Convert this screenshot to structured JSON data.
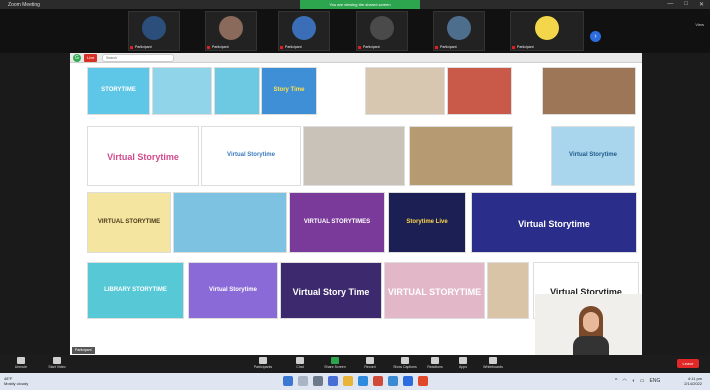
{
  "window": {
    "title": "Zoom Meeting",
    "banner": "You are viewing the shared screen"
  },
  "participants": [
    {
      "name": "Participant",
      "avatar_color": "#2b4f7a"
    },
    {
      "name": "Participant",
      "avatar_color": "#8a6a5a"
    },
    {
      "name": "Participant",
      "avatar_color": "#3a6fb8"
    },
    {
      "name": "Participant",
      "avatar_color": "#4a4a4a"
    },
    {
      "name": "Participant",
      "avatar_color": "#4e6e8e"
    },
    {
      "name": "Participant",
      "avatar_color": "#f3d64a"
    }
  ],
  "strip_next": "›",
  "view_label": "View",
  "browser": {
    "logo": "G",
    "live_badge": "Live",
    "tab_label": "Search"
  },
  "thumbnails": [
    {
      "text": "STORYTIME",
      "bg": "#5ec6e6",
      "fg": "#ffffff"
    },
    {
      "text": "",
      "bg": "#8fd4e8",
      "fg": "#333333"
    },
    {
      "text": "",
      "bg": "#6dc8e2",
      "fg": "#333333"
    },
    {
      "text": "Story Time",
      "bg": "#3e8fd6",
      "fg": "#ffe24a"
    },
    {
      "text": "",
      "bg": "#d8c7b0",
      "fg": "#333333"
    },
    {
      "text": "",
      "bg": "#c95a4a",
      "fg": "#ffffff"
    },
    {
      "text": "",
      "bg": "#9c7656",
      "fg": "#ffffff"
    },
    {
      "text": "Virtual Storytime",
      "bg": "#ffffff",
      "fg": "#d24a8c"
    },
    {
      "text": "Virtual Storytime",
      "bg": "#ffffff",
      "fg": "#3a7ab8"
    },
    {
      "text": "",
      "bg": "#c9c2b8",
      "fg": "#333333"
    },
    {
      "text": "",
      "bg": "#b69a72",
      "fg": "#333333"
    },
    {
      "text": "Virtual Storytime",
      "bg": "#a9d6ec",
      "fg": "#1d5a8c"
    },
    {
      "text": "VIRTUAL STORYTIME",
      "bg": "#f4e6a0",
      "fg": "#4a3a1a"
    },
    {
      "text": "",
      "bg": "#7ec2e2",
      "fg": "#333333"
    },
    {
      "text": "VIRTUAL STORYTIMES",
      "bg": "#7a3a9a",
      "fg": "#ffffff"
    },
    {
      "text": "Storytime Live",
      "bg": "#1b1f54",
      "fg": "#ffd84a"
    },
    {
      "text": "Virtual Storytime",
      "bg": "#2a2d8a",
      "fg": "#ffffff"
    },
    {
      "text": "LIBRARY STORYTIME",
      "bg": "#56c8d6",
      "fg": "#ffffff"
    },
    {
      "text": "Virtual Storytime",
      "bg": "#8a6ad6",
      "fg": "#ffffff"
    },
    {
      "text": "Virtual Story Time",
      "bg": "#3d2a6e",
      "fg": "#ffffff"
    },
    {
      "text": "VIRTUAL STORYTIME",
      "bg": "#e2b8c8",
      "fg": "#ffffff"
    },
    {
      "text": "",
      "bg": "#d9c4a8",
      "fg": "#333333"
    },
    {
      "text": "Virtual Storytime",
      "bg": "#ffffff",
      "fg": "#222222"
    }
  ],
  "name_chip": "Participant",
  "toolbar": {
    "items": [
      {
        "label": "Unmute"
      },
      {
        "label": "Start Video"
      },
      {
        "label": "Participants"
      },
      {
        "label": "Chat"
      },
      {
        "label": "Share Screen"
      },
      {
        "label": "Record"
      },
      {
        "label": "Show Captions"
      },
      {
        "label": "Reactions"
      },
      {
        "label": "Apps"
      },
      {
        "label": "Whiteboards"
      }
    ],
    "leave": "Leave"
  },
  "taskbar": {
    "weather_temp": "48°F",
    "weather_desc": "Mostly cloudy",
    "time": "4:11 pm",
    "date": "2/14/2022",
    "lang": "ENG"
  },
  "colors": {
    "accent": "#2da44e",
    "leave": "#e02828",
    "taskbar": "#dfe6f1"
  }
}
